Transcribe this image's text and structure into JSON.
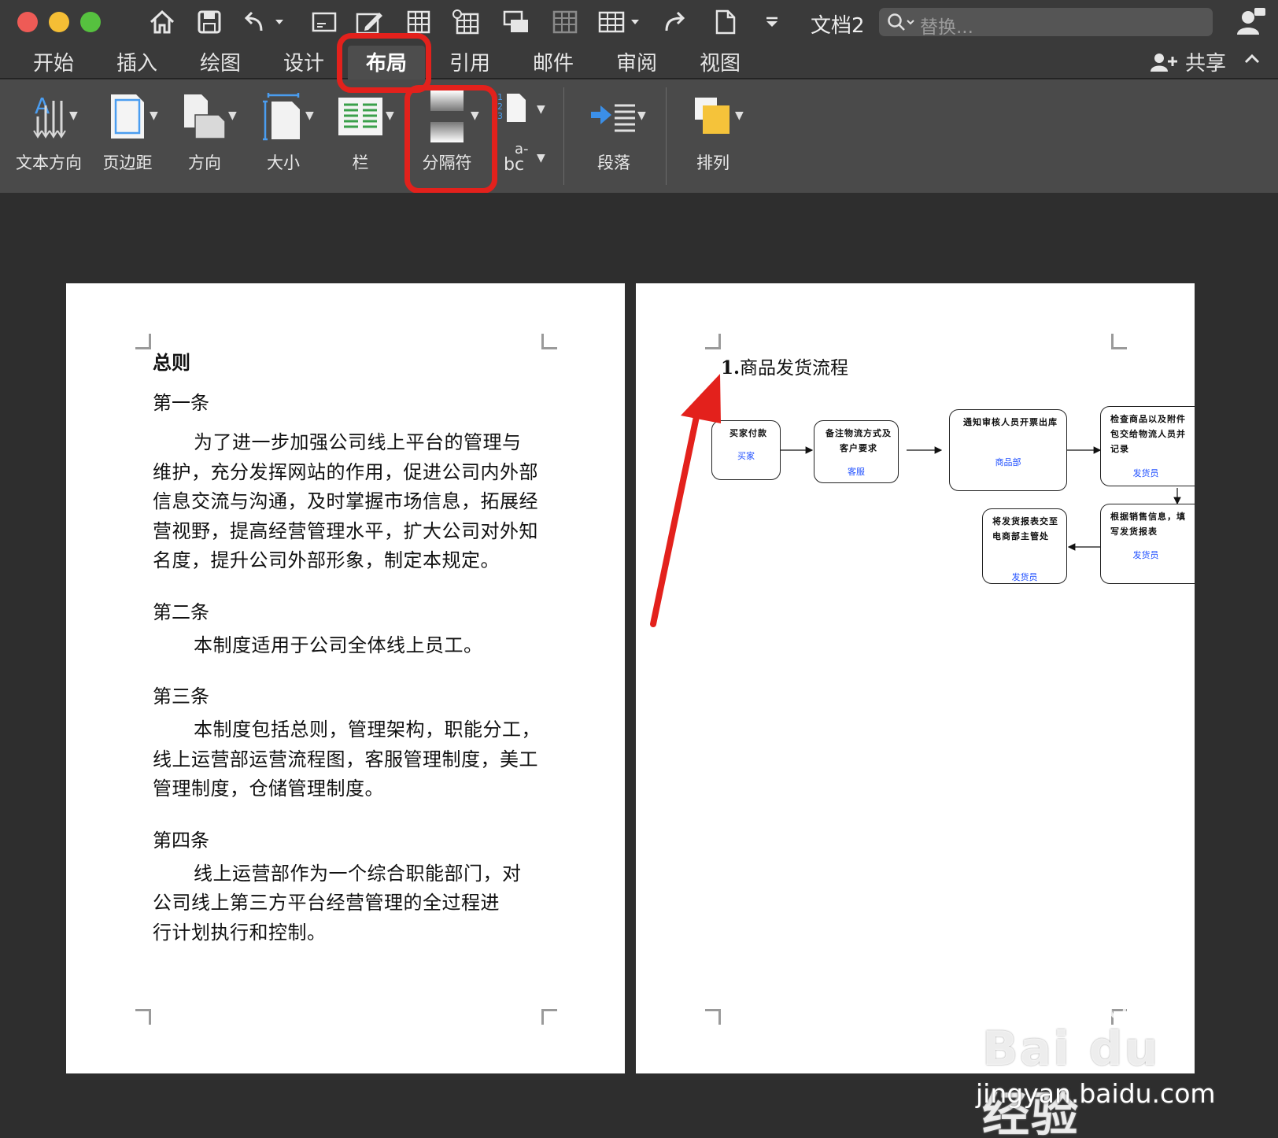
{
  "window": {
    "doc_title": "文档2",
    "search_placeholder": "替换..."
  },
  "tabs": [
    {
      "label": "开始"
    },
    {
      "label": "插入"
    },
    {
      "label": "绘图"
    },
    {
      "label": "设计"
    },
    {
      "label": "布局",
      "active": true
    },
    {
      "label": "引用"
    },
    {
      "label": "邮件"
    },
    {
      "label": "审阅"
    },
    {
      "label": "视图"
    }
  ],
  "share_label": "共享",
  "ribbon": {
    "text_direction": "文本方向",
    "margins": "页边距",
    "orientation": "方向",
    "size": "大小",
    "columns": "栏",
    "breaks": "分隔符",
    "hyphen_top": "a-",
    "hyphen_bottom": "bc",
    "paragraph": "段落",
    "arrange": "排列"
  },
  "page1": {
    "heading": "总则",
    "articles": [
      {
        "title": "第一条",
        "lines": [
          "为了进一步加强公司线上平台的管理与",
          "维护，充分发挥网站的作用，促进公司内外部",
          "信息交流与沟通，及时掌握市场信息，拓展经",
          "营视野，提高经营管理水平，扩大公司对外知",
          "名度，提升公司外部形象，制定本规定。"
        ]
      },
      {
        "title": "第二条",
        "lines": [
          "本制度适用于公司全体线上员工。"
        ]
      },
      {
        "title": "第三条",
        "lines": [
          "本制度包括总则，管理架构，职能分工，",
          "线上运营部运营流程图，客服管理制度，美工",
          "管理制度，仓储管理制度。"
        ]
      },
      {
        "title": "第四条",
        "lines": [
          "线上运营部作为一个综合职能部门，对",
          "公司线上第三方平台经营管理的全过程进",
          "行计划执行和控制。"
        ]
      }
    ]
  },
  "page2": {
    "title_num": "1.",
    "title_text": "商品发货流程",
    "steps": [
      {
        "text": "买家付款",
        "role": "买家"
      },
      {
        "text": "备注物流方式及客户要求",
        "role": "客服"
      },
      {
        "text": "通知审核人员开票出库",
        "role": "商品部"
      },
      {
        "text": "检查商品以及附件包交给物流人员并记录",
        "role": "发货员"
      },
      {
        "text": "根据销售信息，填写发货报表",
        "role": "发货员"
      },
      {
        "text": "将发货报表交至电商部主管处",
        "role": "发货员"
      }
    ]
  },
  "watermark": {
    "logo": "Bai du 经验",
    "url": "jingyan.baidu.com"
  },
  "colors": {
    "highlight_red": "#e3211c",
    "link_blue": "#2050ff"
  }
}
